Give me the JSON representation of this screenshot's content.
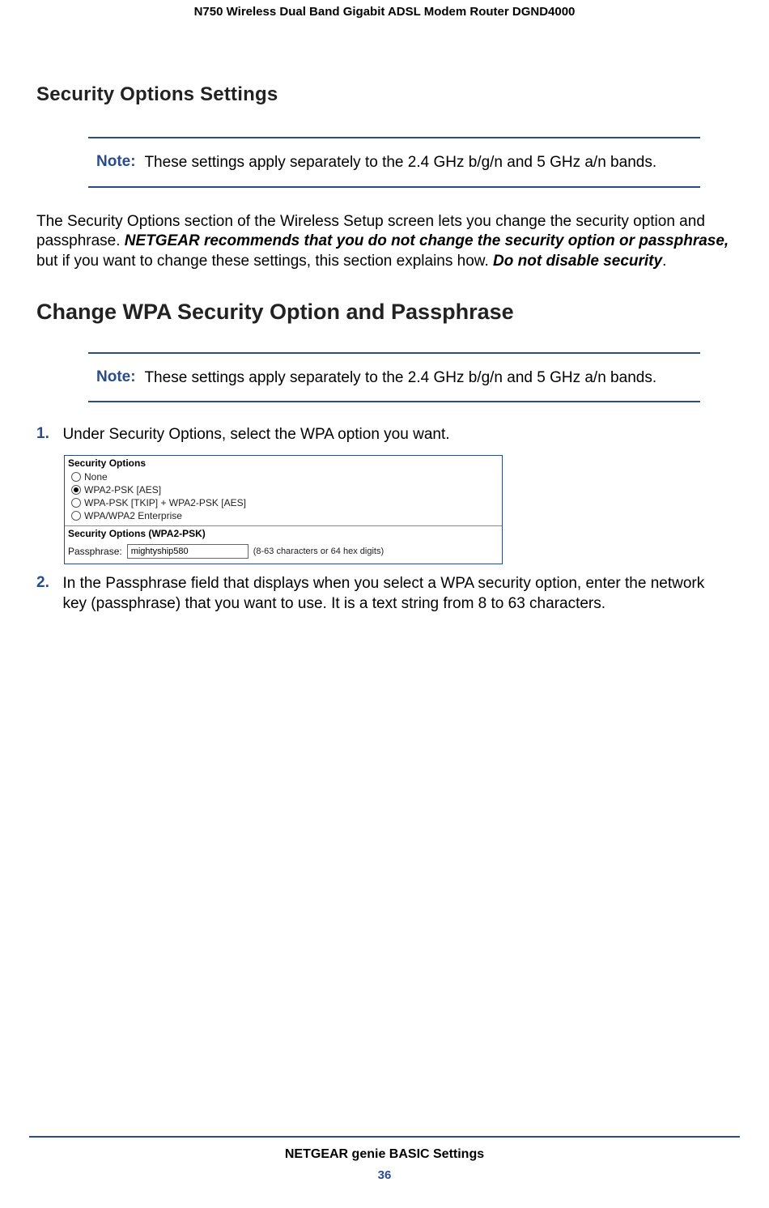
{
  "header": {
    "product": "N750 Wireless Dual Band Gigabit ADSL Modem Router DGND4000"
  },
  "section": {
    "title": "Security Options Settings",
    "note1_label": "Note:",
    "note1_text": "These settings apply separately to the 2.4 GHz b/g/n and 5 GHz a/n bands.",
    "para_a": "The Security Options section of the Wireless Setup screen lets you change the security option and passphrase. ",
    "para_b_strong": "NETGEAR recommends that you do not change the security option or passphrase,",
    "para_c": " but if you want to change these settings, this section explains how. ",
    "para_d_strong": "Do not disable security",
    "para_e": "."
  },
  "subsection": {
    "title": "Change WPA Security Option and Passphrase",
    "note2_label": "Note:",
    "note2_text": "These settings apply separately to the 2.4 GHz b/g/n and 5 GHz a/n bands.",
    "step1_num": "1.",
    "step1_text": "Under Security Options, select the WPA option you want.",
    "step2_num": "2.",
    "step2_text": "In the Passphrase field that displays when you select a WPA security option, enter the network key (passphrase) that you want to use. It is a text string from 8 to 63 characters."
  },
  "figure": {
    "sec1_title": "Security Options",
    "options": [
      {
        "label": "None",
        "selected": false
      },
      {
        "label": "WPA2-PSK [AES]",
        "selected": true
      },
      {
        "label": "WPA-PSK [TKIP] + WPA2-PSK [AES]",
        "selected": false
      },
      {
        "label": "WPA/WPA2 Enterprise",
        "selected": false
      }
    ],
    "sec2_title": "Security Options (WPA2-PSK)",
    "pass_label": "Passphrase:",
    "pass_value": "mightyship580",
    "pass_hint": "(8-63 characters or 64 hex digits)"
  },
  "footer": {
    "title": "NETGEAR genie BASIC Settings",
    "page": "36"
  }
}
